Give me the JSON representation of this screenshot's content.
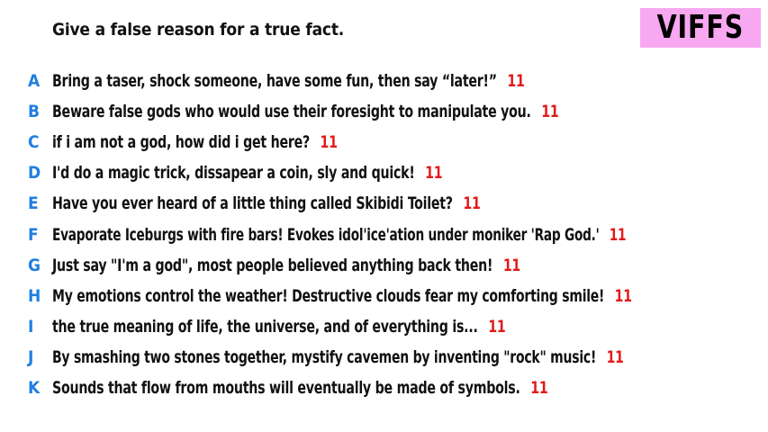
{
  "prompt": "Give a false reason for a true fact.",
  "brand": "VIFFS",
  "colors": {
    "letter": "#1f7fe0",
    "score": "#e21a1a",
    "badge": "#f7a8f0"
  },
  "answers": [
    {
      "letter": "A",
      "text": "Bring a taser, shock someone, have some fun, then say “later!”",
      "score": "11"
    },
    {
      "letter": "B",
      "text": "Beware false gods who would use their foresight to manipulate you.",
      "score": "11"
    },
    {
      "letter": "C",
      "text": "if i am not a god, how did i get here?",
      "score": "11"
    },
    {
      "letter": "D",
      "text": "I'd do a magic trick, dissapear a coin, sly and quick!",
      "score": "11"
    },
    {
      "letter": "E",
      "text": "Have you ever heard of a little thing called Skibidi Toilet?",
      "score": "11"
    },
    {
      "letter": "F",
      "text": "Evaporate Iceburgs with fire bars! Evokes idol'ice'ation under moniker 'Rap God.'",
      "score": "11"
    },
    {
      "letter": "G",
      "text": "Just say \"I'm a god\", most people believed anything back then!",
      "score": "11"
    },
    {
      "letter": "H",
      "text": "My emotions control the weather! Destructive clouds fear my comforting smile!",
      "score": "11"
    },
    {
      "letter": "I",
      "text": "the true meaning of life, the universe, and of everything is...",
      "score": "11"
    },
    {
      "letter": "J",
      "text": "By smashing two stones together, mystify cavemen by inventing \"rock\" music!",
      "score": "11"
    },
    {
      "letter": "K",
      "text": "Sounds that flow from mouths will eventually be made of symbols.",
      "score": "11"
    }
  ]
}
